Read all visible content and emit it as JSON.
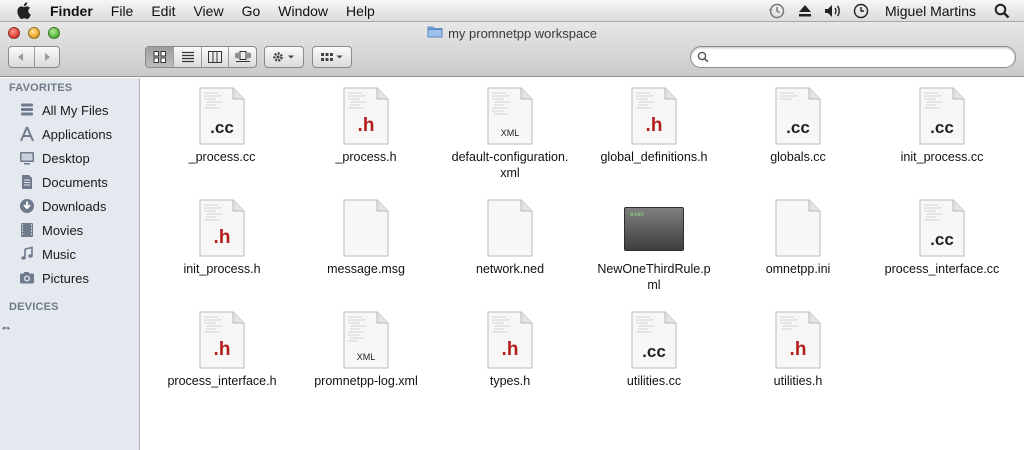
{
  "menubar": {
    "app_name": "Finder",
    "items": [
      "File",
      "Edit",
      "View",
      "Go",
      "Window",
      "Help"
    ],
    "user": "Miguel Martins"
  },
  "window": {
    "title": "my promnetpp workspace"
  },
  "search": {
    "placeholder": ""
  },
  "sidebar": {
    "favorites_header": "FAVORITES",
    "devices_header": "DEVICES",
    "items": [
      {
        "label": "All My Files",
        "icon": "all-files-icon"
      },
      {
        "label": "Applications",
        "icon": "applications-icon"
      },
      {
        "label": "Desktop",
        "icon": "desktop-icon"
      },
      {
        "label": "Documents",
        "icon": "documents-icon"
      },
      {
        "label": "Downloads",
        "icon": "downloads-icon"
      },
      {
        "label": "Movies",
        "icon": "movies-icon"
      },
      {
        "label": "Music",
        "icon": "music-icon"
      },
      {
        "label": "Pictures",
        "icon": "pictures-icon"
      }
    ]
  },
  "files": [
    {
      "name": "_process.cc",
      "badge": ".cc"
    },
    {
      "name": "_process.h",
      "badge": ".h"
    },
    {
      "name": "default-configuration.xml",
      "badge": "XML"
    },
    {
      "name": "global_definitions.h",
      "badge": ".h"
    },
    {
      "name": "globals.cc",
      "badge": ".cc"
    },
    {
      "name": "init_process.cc",
      "badge": ".cc"
    },
    {
      "name": "init_process.h",
      "badge": ".h"
    },
    {
      "name": "message.msg",
      "badge": ""
    },
    {
      "name": "network.ned",
      "badge": ""
    },
    {
      "name": "NewOneThirdRule.pml",
      "badge": "exec"
    },
    {
      "name": "omnetpp.ini",
      "badge": ""
    },
    {
      "name": "process_interface.cc",
      "badge": ".cc"
    },
    {
      "name": "process_interface.h",
      "badge": ".h"
    },
    {
      "name": "promnetpp-log.xml",
      "badge": "XML"
    },
    {
      "name": "types.h",
      "badge": ".h"
    },
    {
      "name": "utilities.cc",
      "badge": ".cc"
    },
    {
      "name": "utilities.h",
      "badge": ".h"
    }
  ]
}
